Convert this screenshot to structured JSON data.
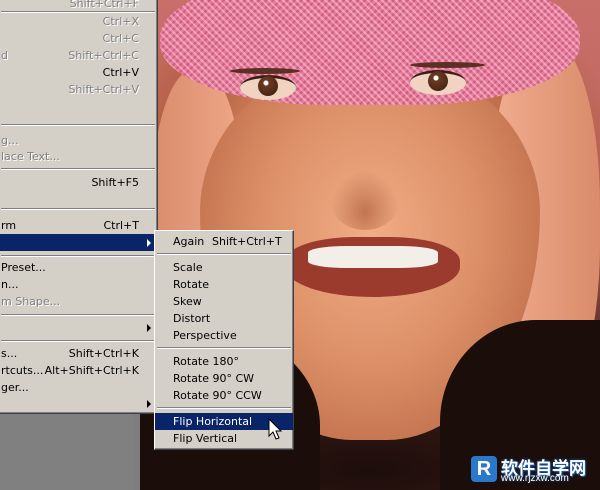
{
  "edit_menu": {
    "items": [
      {
        "label": "",
        "shortcut": "Shift+Ctrl+F",
        "disabled": true
      },
      {
        "label": "",
        "shortcut": "Ctrl+X",
        "disabled": true
      },
      {
        "label": "",
        "shortcut": "Ctrl+C",
        "disabled": true
      },
      {
        "label": "d",
        "shortcut": "Shift+Ctrl+C",
        "disabled": true
      },
      {
        "label": "",
        "shortcut": "Ctrl+V",
        "disabled": false
      },
      {
        "label": "",
        "shortcut": "Shift+Ctrl+V",
        "disabled": true
      },
      {
        "label": "g...",
        "shortcut": "",
        "disabled": true
      },
      {
        "label": "lace Text...",
        "shortcut": "",
        "disabled": true
      },
      {
        "label": "",
        "shortcut": "Shift+F5",
        "disabled": false
      },
      {
        "label": "rm",
        "shortcut": "Ctrl+T",
        "disabled": false
      },
      {
        "label": "",
        "shortcut": "",
        "disabled": false
      },
      {
        "label": "Preset...",
        "shortcut": "",
        "disabled": false
      },
      {
        "label": "n...",
        "shortcut": "",
        "disabled": false
      },
      {
        "label": "m Shape...",
        "shortcut": "",
        "disabled": true
      },
      {
        "label": "",
        "shortcut": "",
        "disabled": false
      },
      {
        "label": "s...",
        "shortcut": "Shift+Ctrl+K",
        "disabled": false
      },
      {
        "label": "rtcuts...",
        "shortcut": "Alt+Shift+Ctrl+K",
        "disabled": false
      },
      {
        "label": "ger...",
        "shortcut": "",
        "disabled": false
      }
    ]
  },
  "transform_submenu": {
    "items": [
      {
        "label": "Again",
        "shortcut": "Shift+Ctrl+T"
      },
      {
        "label": "Scale"
      },
      {
        "label": "Rotate"
      },
      {
        "label": "Skew"
      },
      {
        "label": "Distort"
      },
      {
        "label": "Perspective"
      },
      {
        "label": "Rotate 180°"
      },
      {
        "label": "Rotate 90° CW"
      },
      {
        "label": "Rotate 90° CCW"
      },
      {
        "label": "Flip Horizontal"
      },
      {
        "label": "Flip Vertical"
      }
    ]
  },
  "watermark": {
    "logo": "R",
    "title": "软件自学网",
    "url": "www.rjzxw.com"
  },
  "colors": {
    "menu_bg": "#d4d0c8",
    "highlight": "#0a246a",
    "disabled_text": "#808080"
  }
}
